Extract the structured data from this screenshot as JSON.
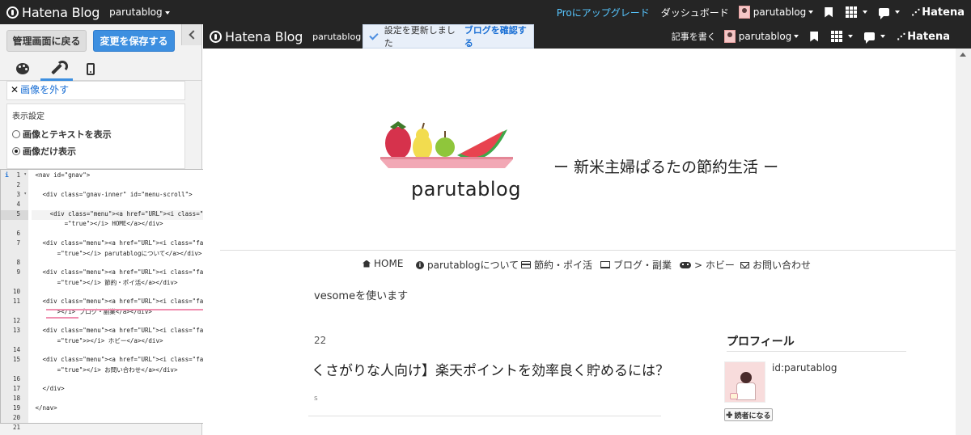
{
  "topbar": {
    "logo_text": "Hatena Blog",
    "blog_name": "parutablog",
    "pro_upgrade": "Proにアップグレード",
    "dashboard": "ダッシュボード",
    "user_name": "parutablog",
    "brand": "Hatena"
  },
  "left_panel": {
    "back_button": "管理画面に戻る",
    "save_button": "変更を保存する",
    "remove_image": "画像を外す",
    "display_settings_title": "表示設定",
    "options": [
      {
        "label": "画像とテキストを表示",
        "checked": false
      },
      {
        "label": "画像だけ表示",
        "checked": true
      }
    ]
  },
  "editor": {
    "line_numbers": [
      "1",
      "2",
      "3",
      "4",
      "5",
      "",
      "7",
      "",
      "9",
      "",
      "10",
      "11",
      "",
      "12",
      "13",
      "",
      "14",
      "15",
      "",
      "16",
      "17",
      "18",
      "19",
      "20",
      "21"
    ],
    "lines": [
      {
        "n": "1",
        "fold": true,
        "text": " <nav id=\"gnav\">"
      },
      {
        "n": "2",
        "text": ""
      },
      {
        "n": "3",
        "fold": true,
        "text": "   <div class=\"gnav-inner\" id=\"menu-scroll\">"
      },
      {
        "n": "4",
        "text": ""
      },
      {
        "n": "5",
        "cur": true,
        "text": "     <div class=\"menu\"><a href=\"URL\"><i class=\"fa fa-home\" aria-hidden"
      },
      {
        "n": "",
        "text": "         =\"true\"></i> HOME</a></div>"
      },
      {
        "n": "6",
        "text": ""
      },
      {
        "n": "7",
        "text": "   <div class=\"menu\"><a href=\"URL\"><i class=\"fa fa-info-circle\" aria-hidden"
      },
      {
        "n": "",
        "text": "       =\"true\"></i> parutablogについて</a></div>"
      },
      {
        "n": "8",
        "text": ""
      },
      {
        "n": "9",
        "text": "   <div class=\"menu\"><a href=\"URL\"><i class=\"fa fa-credit-card\" aria-hidden"
      },
      {
        "n": "",
        "text": "       =\"true\"></i> 節約・ポイ活</a></div>"
      },
      {
        "n": "10",
        "text": ""
      },
      {
        "n": "11",
        "text": "   <div class=\"menu\"><a href=\"URL\"><i class=\"fa fa-laptop\" aria-hidden=\"true\""
      },
      {
        "n": "",
        "text": "       ></i> ブログ・副業</a></div>"
      },
      {
        "n": "12",
        "text": ""
      },
      {
        "n": "13",
        "text": "   <div class=\"menu\"><a href=\"URL\"><i class=\"fa fa-gamepad\" aria-hidden"
      },
      {
        "n": "",
        "text": "       =\"true\">></i> ホビー</a></div>"
      },
      {
        "n": "14",
        "text": ""
      },
      {
        "n": "15",
        "text": "   <div class=\"menu\"><a href=\"URL\"><i class=\"fa fa-envelope-o\" aria-hidden"
      },
      {
        "n": "",
        "text": "       =\"true\"></i> お問い合わせ</a></div>"
      },
      {
        "n": "16",
        "text": ""
      },
      {
        "n": "17",
        "text": "   </div>"
      },
      {
        "n": "18",
        "text": ""
      },
      {
        "n": "19",
        "text": " </nav>"
      },
      {
        "n": "20",
        "text": ""
      },
      {
        "n": "21",
        "text": ""
      }
    ]
  },
  "preview": {
    "logo_text": "Hatena Blog",
    "blog_name": "parutablog",
    "toast_text": "設定を更新しました",
    "toast_link": "ブログを確認する",
    "write_entry": "記事を書く",
    "user_name": "parutablog",
    "brand": "Hatena",
    "site_name": "parutablog",
    "description": "ー 新米主婦ぱるたの節約生活 ー",
    "nav": [
      "HOME",
      "parutablogについて",
      "節約・ポイ活",
      "ブログ・副業",
      "> ホビー",
      "お問い合わせ"
    ],
    "entry_snippet": "vesomeを使います",
    "entry_date": "22",
    "entry_title": "くさがりな人向け】楽天ポイントを効率良く貯めるには？",
    "entry_tag": "s",
    "profile_title": "プロフィール",
    "profile_id": "id:parutablog",
    "reader_button": "読者になる"
  }
}
